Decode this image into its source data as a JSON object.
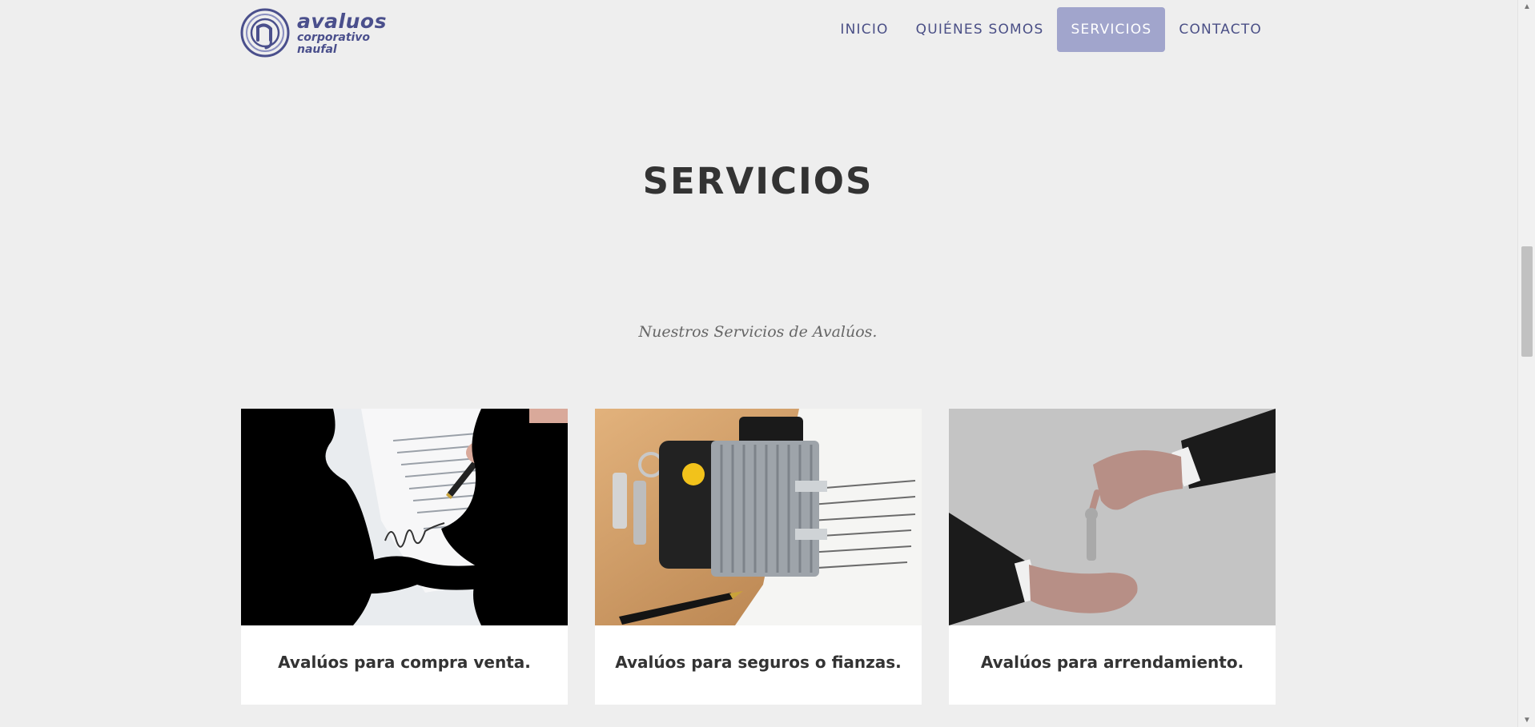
{
  "header": {
    "logo": {
      "line1": "avaluos",
      "line2": "corporativo",
      "line3": "naufal",
      "icon": "logo-mark-icon"
    },
    "nav": [
      {
        "label": "INICIO",
        "active": false
      },
      {
        "label": "QUIÉNES SOMOS",
        "active": false
      },
      {
        "label": "SERVICIOS",
        "active": true
      },
      {
        "label": "CONTACTO",
        "active": false
      }
    ]
  },
  "hero": {
    "title": "SERVICIOS",
    "subtitle": "Nuestros Servicios de Avalúos."
  },
  "cards": [
    {
      "title": "Avalúos para compra venta.",
      "image": "handshake-contract-photo"
    },
    {
      "title": "Avalúos para seguros o fianzas.",
      "image": "padlock-document-photo"
    },
    {
      "title": "Avalúos para arrendamiento.",
      "image": "key-handover-photo"
    }
  ],
  "colors": {
    "brand": "#4a4f86",
    "nav_active_bg": "#a1a5cc",
    "page_bg": "#eeeeee",
    "card_bg": "#ffffff",
    "heading": "#333333"
  }
}
